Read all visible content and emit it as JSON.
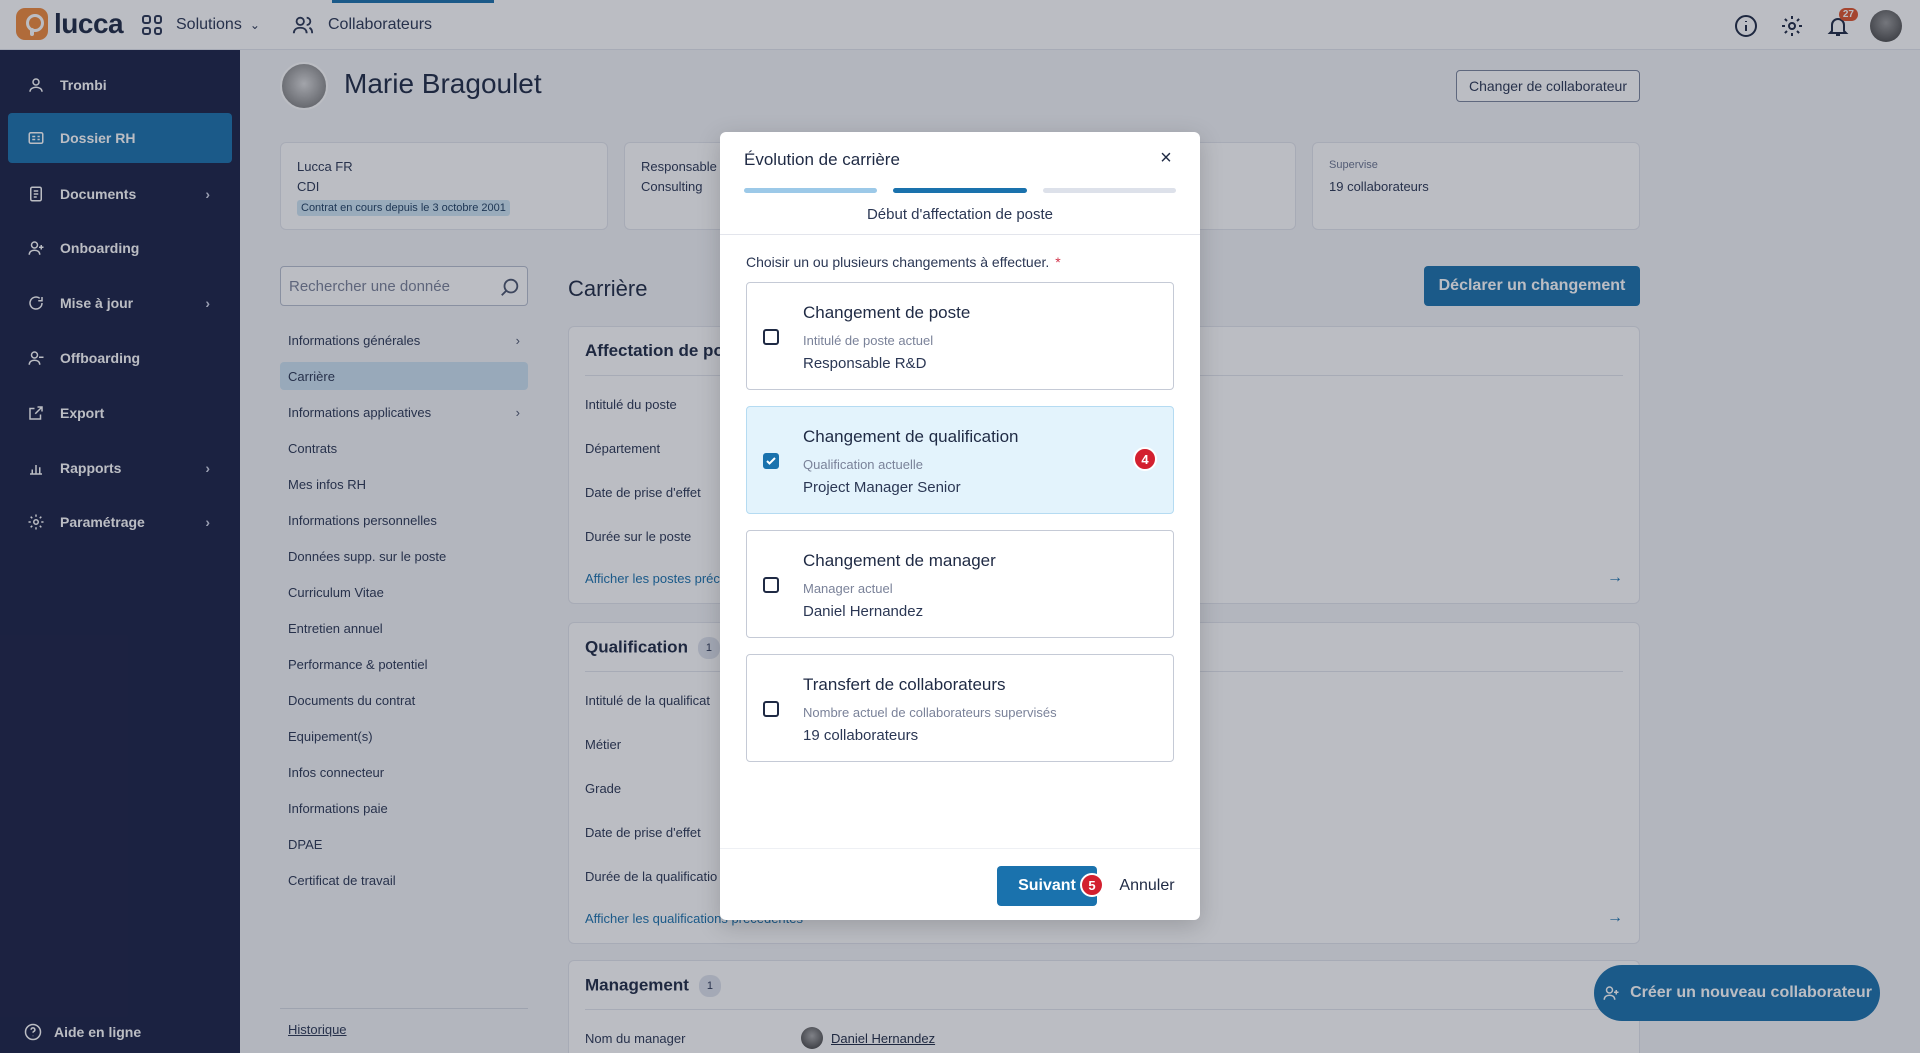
{
  "topbar": {
    "logo_text": "lucca",
    "solutions_label": "Solutions",
    "collaborateurs_label": "Collaborateurs",
    "notification_count": "27"
  },
  "sidebar": {
    "items": [
      {
        "label": "Trombi",
        "icon": "person-icon",
        "active": false,
        "chevron": false
      },
      {
        "label": "Dossier RH",
        "icon": "id-card-icon",
        "active": true,
        "chevron": false
      },
      {
        "label": "Documents",
        "icon": "document-icon",
        "active": false,
        "chevron": true
      },
      {
        "label": "Onboarding",
        "icon": "user-plus-icon",
        "active": false,
        "chevron": false
      },
      {
        "label": "Mise à jour",
        "icon": "refresh-icon",
        "active": false,
        "chevron": true
      },
      {
        "label": "Offboarding",
        "icon": "user-minus-icon",
        "active": false,
        "chevron": false
      },
      {
        "label": "Export",
        "icon": "export-icon",
        "active": false,
        "chevron": false
      },
      {
        "label": "Rapports",
        "icon": "chart-icon",
        "active": false,
        "chevron": true
      },
      {
        "label": "Paramétrage",
        "icon": "gear-icon",
        "active": false,
        "chevron": true
      }
    ],
    "help_label": "Aide en ligne"
  },
  "profile": {
    "name": "Marie Bragoulet",
    "change_button": "Changer de collaborateur"
  },
  "cards": {
    "company": "Lucca FR",
    "contract_type": "CDI",
    "contract_chip": "Contrat en cours depuis le 3 octobre 2001",
    "role_line1": "Responsable",
    "role_line2": "Consulting",
    "supervise_label": "Supervise",
    "supervise_value": "19 collaborateurs"
  },
  "search": {
    "placeholder": "Rechercher une donnée"
  },
  "menu": [
    {
      "label": "Informations générales",
      "chevron": true,
      "active": false
    },
    {
      "label": "Carrière",
      "chevron": false,
      "active": true
    },
    {
      "label": "Informations applicatives",
      "chevron": true,
      "active": false
    },
    {
      "label": "Contrats",
      "chevron": false,
      "active": false
    },
    {
      "label": "Mes infos RH",
      "chevron": false,
      "active": false
    },
    {
      "label": "Informations personnelles",
      "chevron": false,
      "active": false
    },
    {
      "label": "Données supp. sur le poste",
      "chevron": false,
      "active": false
    },
    {
      "label": "Curriculum Vitae",
      "chevron": false,
      "active": false
    },
    {
      "label": "Entretien annuel",
      "chevron": false,
      "active": false
    },
    {
      "label": "Performance & potentiel",
      "chevron": false,
      "active": false
    },
    {
      "label": "Documents du contrat",
      "chevron": false,
      "active": false
    },
    {
      "label": "Equipement(s)",
      "chevron": false,
      "active": false
    },
    {
      "label": "Infos connecteur",
      "chevron": false,
      "active": false
    },
    {
      "label": "Informations paie",
      "chevron": false,
      "active": false
    },
    {
      "label": "DPAE",
      "chevron": false,
      "active": false
    },
    {
      "label": "Certificat de travail",
      "chevron": false,
      "active": false
    }
  ],
  "historique_label": "Historique",
  "career": {
    "title": "Carrière",
    "declare_button": "Déclarer un changement",
    "affectation": {
      "title": "Affectation de pos",
      "fields": [
        "Intitulé du poste",
        "Département",
        "Date de prise d'effet",
        "Durée sur le poste"
      ],
      "link": "Afficher les postes préc"
    },
    "qualification": {
      "title": "Qualification",
      "count": "1",
      "fields": [
        "Intitulé de la qualificat",
        "Métier",
        "Grade",
        "Date de prise d'effet",
        "Durée de la qualificatio"
      ],
      "link": "Afficher les qualifications précédentes"
    },
    "management": {
      "title": "Management",
      "count": "1",
      "field": "Nom du manager",
      "manager_name": "Daniel Hernandez"
    }
  },
  "fab_label": "Créer un nouveau collaborateur",
  "modal": {
    "title": "Évolution de carrière",
    "close": "×",
    "steps": [
      {
        "state": "done"
      },
      {
        "state": "current"
      },
      {
        "state": "todo"
      }
    ],
    "step_caption": "Début d'affectation de poste",
    "question": "Choisir un ou plusieurs changements à effectuer.",
    "required_mark": "*",
    "options": [
      {
        "title": "Changement de poste",
        "sub": "Intitulé de poste actuel",
        "value": "Responsable R&D",
        "checked": false
      },
      {
        "title": "Changement de qualification",
        "sub": "Qualification actuelle",
        "value": "Project Manager Senior",
        "checked": true,
        "badge": "4"
      },
      {
        "title": "Changement de manager",
        "sub": "Manager actuel",
        "value": "Daniel Hernandez",
        "checked": false
      },
      {
        "title": "Transfert de collaborateurs",
        "sub": "Nombre actuel de collaborateurs supervisés",
        "value": "19 collaborateurs",
        "checked": false
      }
    ],
    "next_button": "Suivant",
    "next_badge": "5",
    "cancel_button": "Annuler"
  },
  "colors": {
    "primary": "#1a72ad",
    "sidebar": "#1b2145",
    "badge": "#d3202f",
    "accent_orange": "#f08a3c"
  }
}
